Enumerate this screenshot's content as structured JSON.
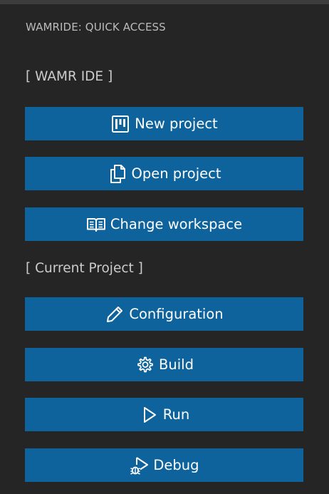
{
  "panel": {
    "title": "WAMRIDE: QUICK ACCESS"
  },
  "sections": {
    "ide_label": "[ WAMR IDE ]",
    "project_label": "[ Current Project ]"
  },
  "buttons": {
    "new_project": {
      "label": "New project",
      "icon": "project-board-icon"
    },
    "open_project": {
      "label": "Open project",
      "icon": "copy-files-icon"
    },
    "change_workspace": {
      "label": "Change workspace",
      "icon": "book-icon"
    },
    "configuration": {
      "label": "Configuration",
      "icon": "pencil-icon"
    },
    "build": {
      "label": "Build",
      "icon": "gear-icon"
    },
    "run": {
      "label": "Run",
      "icon": "play-icon"
    },
    "debug": {
      "label": "Debug",
      "icon": "debug-icon"
    }
  },
  "colors": {
    "background": "#252526",
    "button": "#0e639c",
    "button_text": "#ffffff",
    "label_text": "#cccccc"
  }
}
